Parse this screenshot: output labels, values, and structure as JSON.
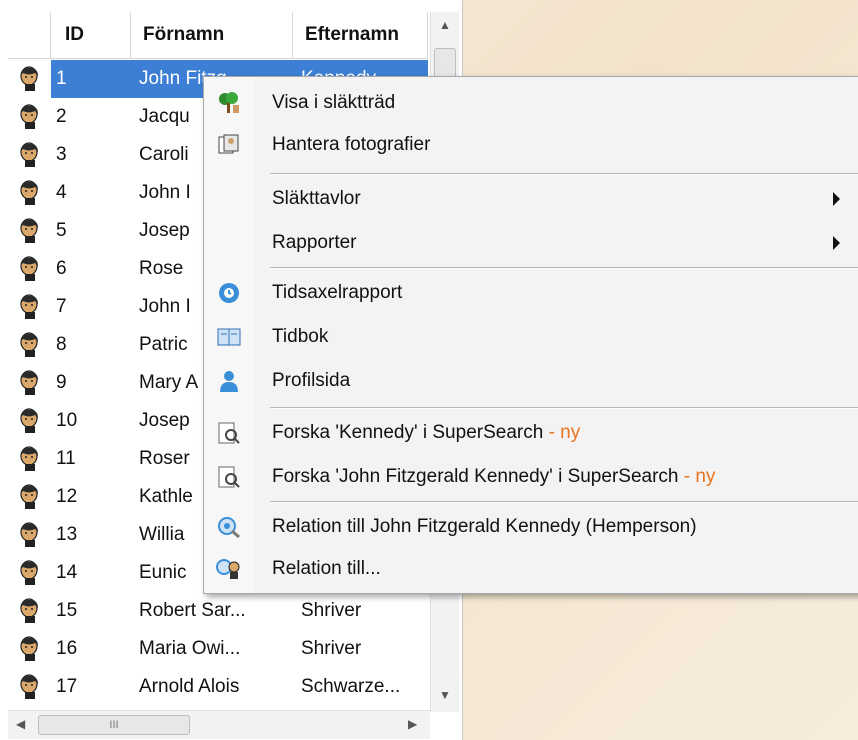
{
  "grid": {
    "headers": {
      "id": "ID",
      "first_name": "Förnamn",
      "last_name": "Efternamn"
    },
    "rows": [
      {
        "id": "1",
        "first_name": "John Fitzg...",
        "last_name": "Kennedy",
        "selected": true
      },
      {
        "id": "2",
        "first_name": "Jacqu",
        "last_name": ""
      },
      {
        "id": "3",
        "first_name": "Caroli",
        "last_name": ""
      },
      {
        "id": "4",
        "first_name": "John I",
        "last_name": ""
      },
      {
        "id": "5",
        "first_name": "Josep",
        "last_name": ""
      },
      {
        "id": "6",
        "first_name": "Rose",
        "last_name": ""
      },
      {
        "id": "7",
        "first_name": "John I",
        "last_name": ""
      },
      {
        "id": "8",
        "first_name": "Patric",
        "last_name": ""
      },
      {
        "id": "9",
        "first_name": "Mary A",
        "last_name": ""
      },
      {
        "id": "10",
        "first_name": "Josep",
        "last_name": ""
      },
      {
        "id": "11",
        "first_name": "Roser",
        "last_name": ""
      },
      {
        "id": "12",
        "first_name": "Kathle",
        "last_name": ""
      },
      {
        "id": "13",
        "first_name": "Willia",
        "last_name": ""
      },
      {
        "id": "14",
        "first_name": "Eunic",
        "last_name": ""
      },
      {
        "id": "15",
        "first_name": "Robert Sar...",
        "last_name": "Shriver"
      },
      {
        "id": "16",
        "first_name": "Maria Owi...",
        "last_name": "Shriver"
      },
      {
        "id": "17",
        "first_name": "Arnold Alois",
        "last_name": "Schwarze..."
      }
    ],
    "hscroll_thumb_label": "III"
  },
  "menu": {
    "items": [
      {
        "label": "Visa i släktträd",
        "icon": "family-tree-icon"
      },
      {
        "label": "Hantera fotografier",
        "icon": "photos-icon"
      },
      {
        "label": "Släkttavlor",
        "submenu": true
      },
      {
        "label": "Rapporter",
        "submenu": true
      },
      {
        "label": "Tidsaxelrapport",
        "icon": "timeline-icon"
      },
      {
        "label": "Tidbok",
        "icon": "book-icon"
      },
      {
        "label": "Profilsida",
        "icon": "person-icon"
      },
      {
        "label": "Forska 'Kennedy' i SuperSearch",
        "suffix": " - ny",
        "icon": "search-document-icon"
      },
      {
        "label": "Forska 'John Fitzgerald Kennedy' i SuperSearch",
        "suffix": " - ny",
        "icon": "search-document-icon"
      },
      {
        "label": "Relation till John Fitzgerald Kennedy (Hemperson)",
        "icon": "relation-icon"
      },
      {
        "label": "Relation till...",
        "icon": "relation-people-icon"
      }
    ]
  },
  "colors": {
    "selection": "#3c7fd5",
    "new_badge": "#e8741d"
  }
}
